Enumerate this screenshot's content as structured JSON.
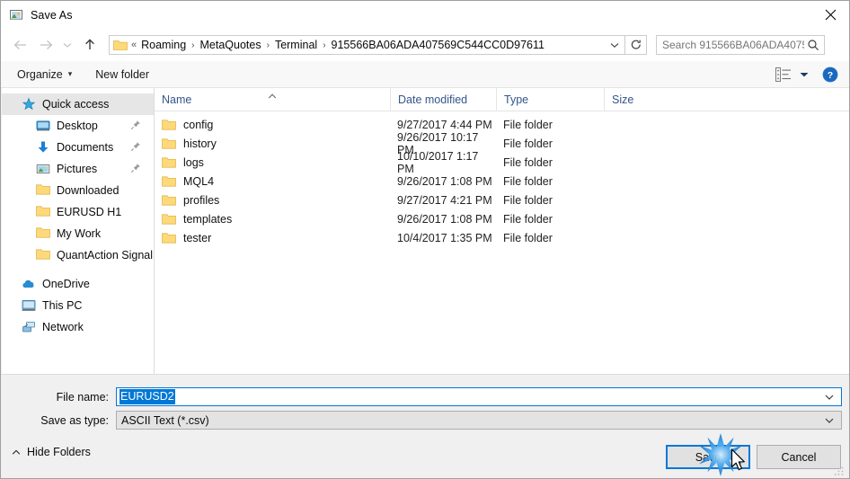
{
  "window": {
    "title": "Save As",
    "icon": "save-as-icon",
    "close_label": "✕"
  },
  "navbar": {
    "back_icon": "back-arrow-icon",
    "forward_icon": "forward-arrow-icon",
    "recent_icon": "recent-locations-icon",
    "up_icon": "up-arrow-icon",
    "breadcrumb_prefix": "«",
    "breadcrumbs": [
      {
        "label": "Roaming"
      },
      {
        "label": "MetaQuotes"
      },
      {
        "label": "Terminal"
      },
      {
        "label": "915566BA06ADA407569C544CC0D97611"
      }
    ],
    "separator": "›",
    "refresh_icon": "refresh-icon",
    "dropdown_icon": "chevron-down-icon",
    "search": {
      "placeholder": "Search 915566BA06ADA40756...",
      "value": "",
      "icon": "search-icon"
    }
  },
  "toolbar": {
    "organize_label": "Organize",
    "new_folder_label": "New folder",
    "caret": "▾",
    "view_icon": "view-layout-icon",
    "help_icon": "help-icon"
  },
  "sidebar": {
    "items": [
      {
        "label": "Quick access",
        "icon": "star-icon",
        "level": 0,
        "selected": true,
        "pinned": false
      },
      {
        "label": "Desktop",
        "icon": "desktop-icon",
        "level": 1,
        "selected": false,
        "pinned": true
      },
      {
        "label": "Documents",
        "icon": "documents-icon",
        "level": 1,
        "selected": false,
        "pinned": true
      },
      {
        "label": "Pictures",
        "icon": "pictures-icon",
        "level": 1,
        "selected": false,
        "pinned": true
      },
      {
        "label": "Downloaded",
        "icon": "folder-icon",
        "level": 1,
        "selected": false,
        "pinned": false
      },
      {
        "label": "EURUSD H1",
        "icon": "folder-icon",
        "level": 1,
        "selected": false,
        "pinned": false
      },
      {
        "label": "My Work",
        "icon": "folder-icon",
        "level": 1,
        "selected": false,
        "pinned": false
      },
      {
        "label": "QuantAction Signal",
        "icon": "folder-icon",
        "level": 1,
        "selected": false,
        "pinned": false
      },
      {
        "label": "OneDrive",
        "icon": "onedrive-icon",
        "level": 0,
        "selected": false,
        "pinned": false
      },
      {
        "label": "This PC",
        "icon": "this-pc-icon",
        "level": 0,
        "selected": false,
        "pinned": false
      },
      {
        "label": "Network",
        "icon": "network-icon",
        "level": 0,
        "selected": false,
        "pinned": false
      }
    ]
  },
  "filelist": {
    "columns": [
      "Name",
      "Date modified",
      "Type",
      "Size"
    ],
    "sort_column": "Name",
    "sort_direction": "ascending",
    "rows": [
      {
        "name": "config",
        "date": "9/27/2017 4:44 PM",
        "type": "File folder",
        "size": ""
      },
      {
        "name": "history",
        "date": "9/26/2017 10:17 PM",
        "type": "File folder",
        "size": ""
      },
      {
        "name": "logs",
        "date": "10/10/2017 1:17 PM",
        "type": "File folder",
        "size": ""
      },
      {
        "name": "MQL4",
        "date": "9/26/2017 1:08 PM",
        "type": "File folder",
        "size": ""
      },
      {
        "name": "profiles",
        "date": "9/27/2017 4:21 PM",
        "type": "File folder",
        "size": ""
      },
      {
        "name": "templates",
        "date": "9/26/2017 1:08 PM",
        "type": "File folder",
        "size": ""
      },
      {
        "name": "tester",
        "date": "10/4/2017 1:35 PM",
        "type": "File folder",
        "size": ""
      }
    ]
  },
  "form": {
    "file_name_label": "File name:",
    "file_name_value": "EURUSD2",
    "file_name_selected": true,
    "save_as_type_label": "Save as type:",
    "save_as_type_value": "ASCII Text (*.csv)"
  },
  "footer": {
    "hide_folders_label": "Hide Folders",
    "hide_folders_caret": "˄",
    "save_label": "Save",
    "cancel_label": "Cancel",
    "save_focused": true
  },
  "colors": {
    "accent": "#0078d7",
    "selection": "#0078d7",
    "header_text": "#33558b",
    "folder_yellow": "#fdd97a",
    "dialog_bg": "#f0f0f0",
    "pane_bg": "#ffffff"
  }
}
